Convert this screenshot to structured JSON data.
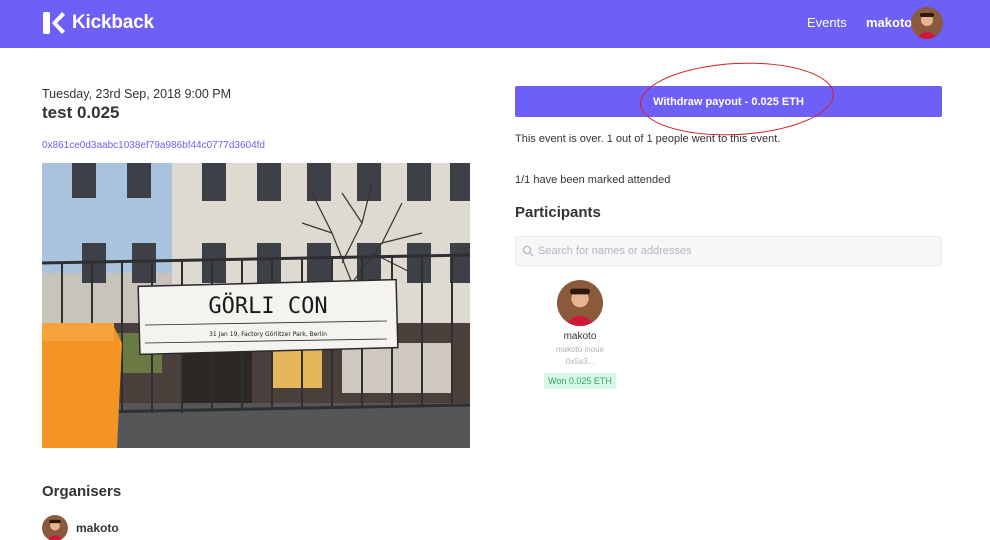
{
  "header": {
    "brand": "Kickback",
    "nav_events": "Events",
    "username": "makoto"
  },
  "event": {
    "date": "Tuesday, 23rd Sep, 2018 9:00 PM",
    "title": "test 0.025",
    "address": "0x861ce0d3aabc1038ef79a986bf44c0777d3604fd",
    "image_sign_text": "GÖRLI CON",
    "image_sign_subtext": "31 Jan 19, Factory Görlitzer Park, Berlin"
  },
  "actions": {
    "withdraw_label": "Withdraw payout - 0.025 ETH"
  },
  "status": {
    "summary": "This event is over. 1 out of 1 people went to this event.",
    "attended": "1/1 have been marked attended"
  },
  "participants": {
    "heading": "Participants",
    "search_placeholder": "Search for names or addresses",
    "items": [
      {
        "username": "makoto",
        "real_name": "makoto inoue",
        "address": "0x5a3...",
        "badge": "Won 0.025 ETH"
      }
    ]
  },
  "organisers": {
    "heading": "Organisers",
    "items": [
      {
        "username": "makoto"
      }
    ]
  },
  "colors": {
    "brand": "#6e60f7",
    "won_badge_bg": "#d9f7e6",
    "won_badge_text": "#2eaa64",
    "annotation": "#d41f1f"
  }
}
